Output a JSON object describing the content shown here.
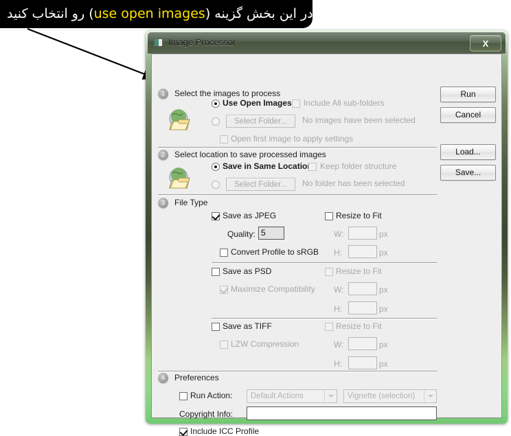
{
  "annotation": {
    "text_before": "در این بخش گزینه (",
    "highlight": "use open images",
    "text_after": ") رو انتخاب کنید",
    "highlight_color": "#ffe400",
    "background_color": "#000000"
  },
  "window": {
    "title": "Image Processor",
    "close_label": "X",
    "icon_name": "image-processor-icon"
  },
  "sections": {
    "one": {
      "number": "1",
      "title": "Select the images to process",
      "radio_use_open_images": "Use Open Images",
      "checkbox_include_subfolders": "Include All sub-folders",
      "select_folder_button": "Select Folder...",
      "no_images_status": "No images have been selected",
      "checkbox_open_first_image": "Open first image to apply settings"
    },
    "two": {
      "number": "2",
      "title": "Select location to save processed images",
      "radio_save_same_location": "Save in Same Location",
      "checkbox_keep_folder_structure": "Keep folder structure",
      "select_folder_button": "Select Folder...",
      "no_folder_status": "No folder has been selected"
    },
    "three": {
      "number": "3",
      "title": "File Type",
      "jpeg": {
        "checkbox": "Save as JPEG",
        "quality_label": "Quality:",
        "quality_value": "5",
        "convert_srgb": "Convert Profile to sRGB",
        "resize_to_fit": "Resize to Fit",
        "w_label": "W:",
        "h_label": "H:",
        "w_value": "",
        "h_value": "",
        "unit": "px"
      },
      "psd": {
        "checkbox": "Save as PSD",
        "maximize_compatibility": "Maximize Compatibility",
        "resize_to_fit": "Resize to Fit",
        "w_label": "W:",
        "h_label": "H:",
        "w_value": "",
        "h_value": "",
        "unit": "px"
      },
      "tiff": {
        "checkbox": "Save as TIFF",
        "lzw_compression": "LZW Compression",
        "resize_to_fit": "Resize to Fit",
        "w_label": "W:",
        "h_label": "H:",
        "w_value": "",
        "h_value": "",
        "unit": "px"
      }
    },
    "four": {
      "number": "4",
      "title": "Preferences",
      "run_action_checkbox": "Run Action:",
      "action_set_value": "Default Actions",
      "action_value": "Vignette (selection)",
      "copyright_label": "Copyright Info:",
      "copyright_value": "",
      "include_icc_profile": "Include ICC Profile"
    }
  },
  "buttons": {
    "run": "Run",
    "cancel": "Cancel",
    "load": "Load...",
    "save": "Save..."
  }
}
